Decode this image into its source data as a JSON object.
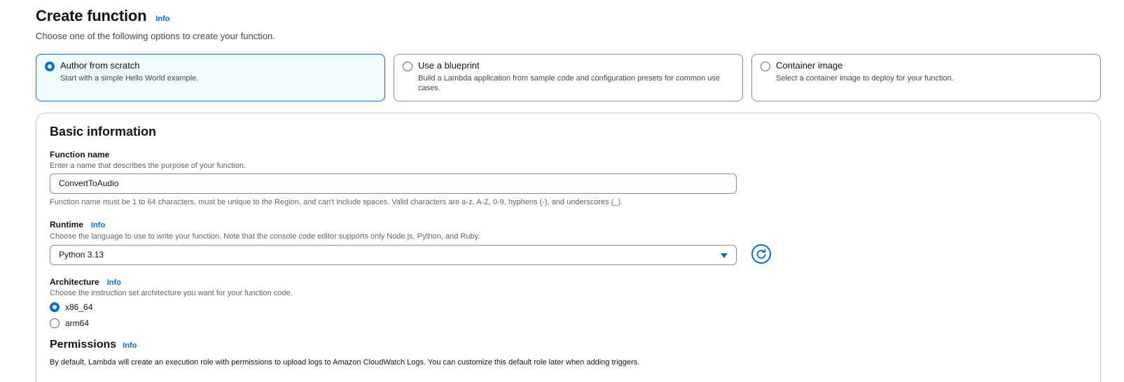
{
  "header": {
    "title": "Create function",
    "info": "Info",
    "subtitle": "Choose one of the following options to create your function."
  },
  "options": [
    {
      "title": "Author from scratch",
      "description": "Start with a simple Hello World example.",
      "selected": true
    },
    {
      "title": "Use a blueprint",
      "description": "Build a Lambda application from sample code and configuration presets for common use cases.",
      "selected": false
    },
    {
      "title": "Container image",
      "description": "Select a container image to deploy for your function.",
      "selected": false
    }
  ],
  "basic_info": {
    "title": "Basic information",
    "function_name": {
      "label": "Function name",
      "description": "Enter a name that describes the purpose of your function.",
      "value": "ConvertToAudio",
      "constraint": "Function name must be 1 to 64 characters, must be unique to the Region, and can't include spaces. Valid characters are a-z, A-Z, 0-9, hyphens (-), and underscores (_)."
    },
    "runtime": {
      "label": "Runtime",
      "info": "Info",
      "description": "Choose the language to use to write your function. Note that the console code editor supports only Node.js, Python, and Ruby.",
      "value": "Python 3.13"
    },
    "architecture": {
      "label": "Architecture",
      "info": "Info",
      "description": "Choose the instruction set architecture you want for your function code.",
      "options": [
        {
          "label": "x86_64",
          "selected": true
        },
        {
          "label": "arm64",
          "selected": false
        }
      ]
    },
    "permissions": {
      "title": "Permissions",
      "info": "Info",
      "description": "By default, Lambda will create an execution role with permissions to upload logs to Amazon CloudWatch Logs. You can customize this default role later when adding triggers."
    }
  },
  "colors": {
    "accent": "#006ce0",
    "selected_tile_bg": "#f0fbff",
    "text": "#0f141a",
    "muted_text": "#5f6470"
  }
}
